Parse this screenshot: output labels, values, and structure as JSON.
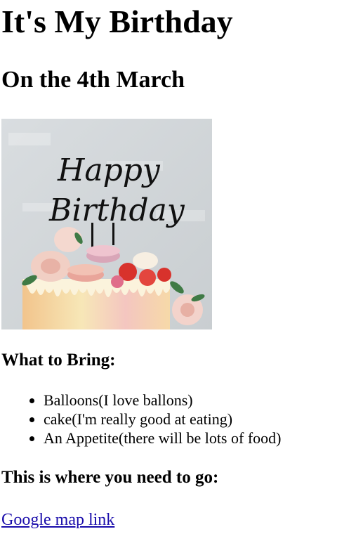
{
  "page": {
    "title": "It's My Birthday",
    "subtitle": "On the 4th March"
  },
  "image": {
    "topper_line1": "Happy",
    "topper_line2": "Birthday",
    "icon": "birthday-cake-photo"
  },
  "bring": {
    "heading": "What to Bring:",
    "items": [
      "Balloons(I love ballons)",
      "cake(I'm really good at eating)",
      "An Appetite(there will be lots of food)"
    ]
  },
  "location": {
    "heading": "This is where you need to go:",
    "link_text": "Google map link"
  },
  "colors": {
    "link": "#1a0dab",
    "text": "#000000",
    "background": "#ffffff"
  }
}
